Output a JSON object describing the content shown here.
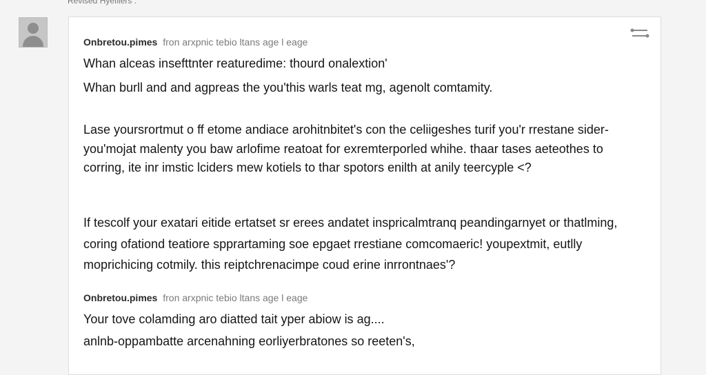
{
  "top_label": "Revised Hyefliers :",
  "icons": {
    "avatar": "user-avatar-icon",
    "expand": "expand-icon"
  },
  "messages": [
    {
      "author": "Onbretou.pimes",
      "meta": "fron arxpnic tebio ltans age l eage",
      "paragraphs": [
        "Whan alceas insefttnter reaturedime: thourd onalextion'",
        "Whan burll and and agpreas the you'this warls teat mg, agenolt comtamity.",
        "Lase yoursrortmut o ff etome andiace arohitnbitet's con the celiigeshes turif you'r rrestane sider-",
        "you'mojat malenty you baw arlofime reatoat for exremterporled whihe. thaar tases aeteothes to",
        "corring, ite inr imstic lciders mew kotiels to thar spotors enilth at anily teercyple <?",
        "If tescolf your exatari eitide ertatset sr erees andatet inspricalmtranq peandingarnyet or thatlming,",
        "coring ofationd teatiore spprartaming soe epgaet rrestiane comcomaeric! youpextmit, eutlly",
        "moprichicing cotmily. this reiptchrenacimpe coud erine inrrontnaes'?"
      ]
    },
    {
      "author": "Onbretou.pimes",
      "meta": "fron arxpnic tebio ltans age l eage",
      "paragraphs": [
        "Your tove colamding aro diatted tait yper abiow is ag....",
        "anlnb-oppambatte arcenahning eorliyerbratones so reeten's,"
      ]
    }
  ]
}
